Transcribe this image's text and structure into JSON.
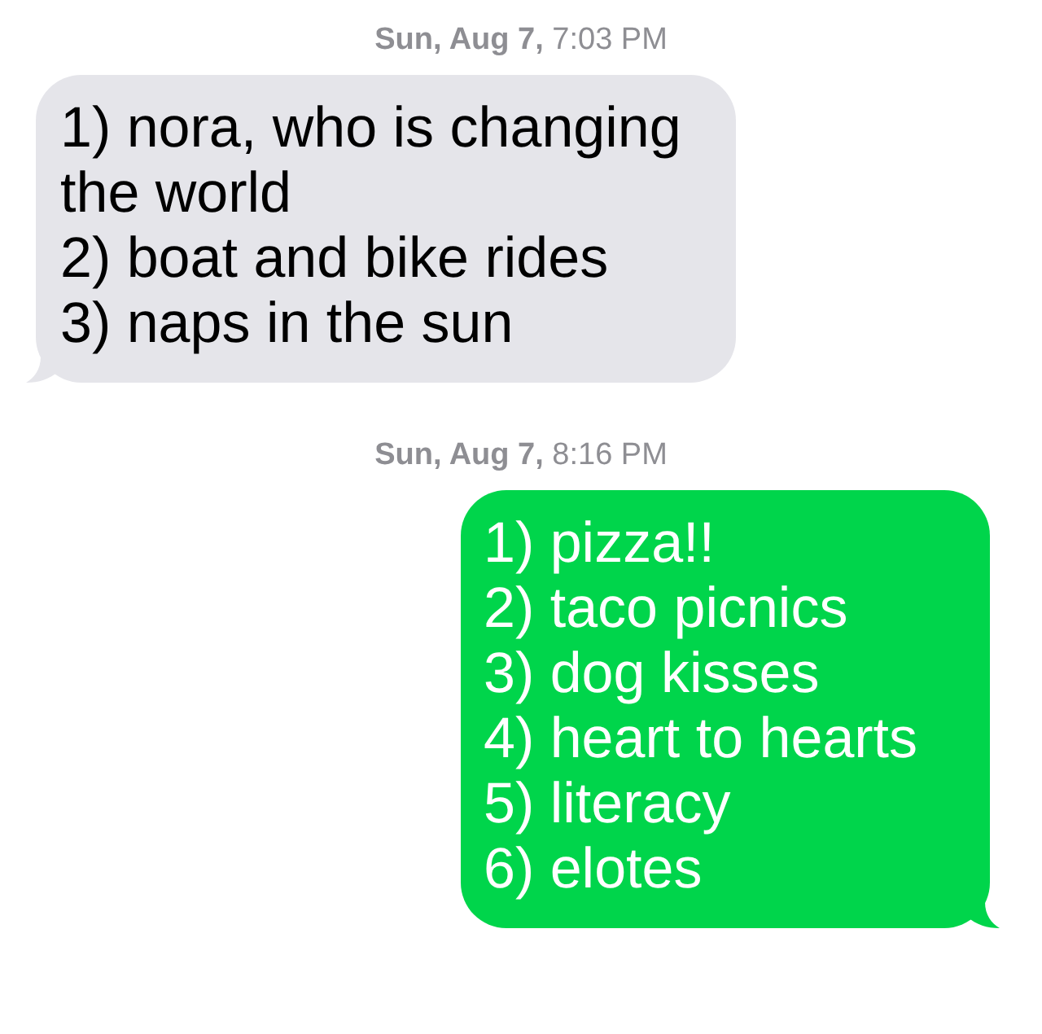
{
  "conversation": [
    {
      "timestamp": "**Sun, Aug 7,** 7:03 PM",
      "outgoing": false,
      "lines": [
        "1) nora, who is changing the world",
        "2) boat and bike rides",
        "3) naps in the sun"
      ]
    },
    {
      "timestamp": "**Sun, Aug 7,** 8:16 PM",
      "outgoing": true,
      "lines": [
        "1) pizza!!",
        "2) taco picnics",
        "3) dog kisses",
        "4) heart to hearts",
        "5) literacy",
        "6) elotes"
      ]
    }
  ]
}
